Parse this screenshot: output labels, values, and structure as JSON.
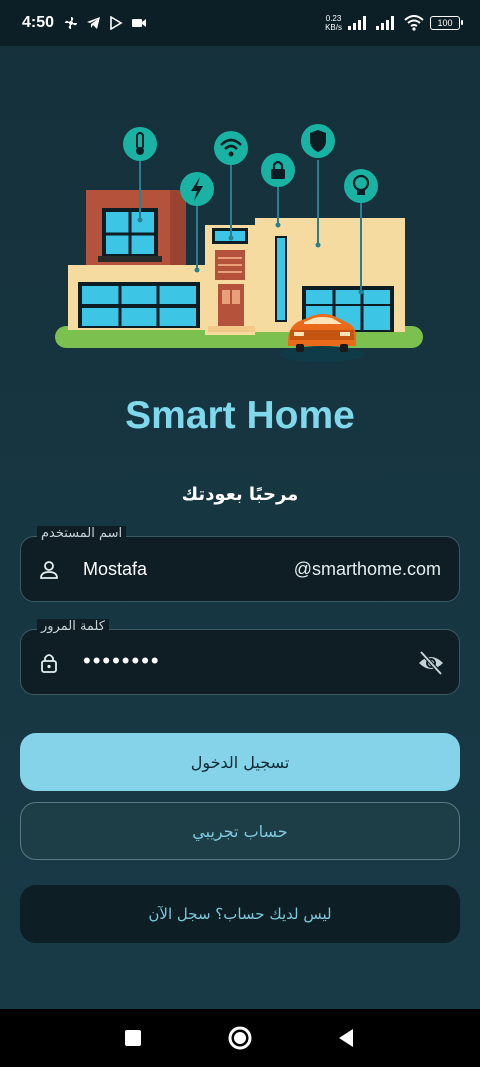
{
  "status_bar": {
    "time": "4:50",
    "speed_value": "0.23",
    "speed_unit": "KB/s",
    "battery": "100"
  },
  "app": {
    "title": "Smart Home",
    "welcome": "مرحبًا بعودتك"
  },
  "form": {
    "username_label": "اسم المستخدم",
    "username_value": "Mostafa",
    "username_suffix": "@smarthome.com",
    "password_label": "كلمة المرور",
    "password_value": "••••••••"
  },
  "buttons": {
    "login": "تسجيل الدخول",
    "demo": "حساب تجريبي",
    "register": "ليس لديك حساب؟ سجل الآن"
  },
  "colors": {
    "accent": "#84d3e8",
    "title": "#7fd8ec",
    "background": "#163540"
  },
  "icons": {
    "username": "person-icon",
    "password": "lock-icon",
    "visibility": "eye-off-icon"
  }
}
